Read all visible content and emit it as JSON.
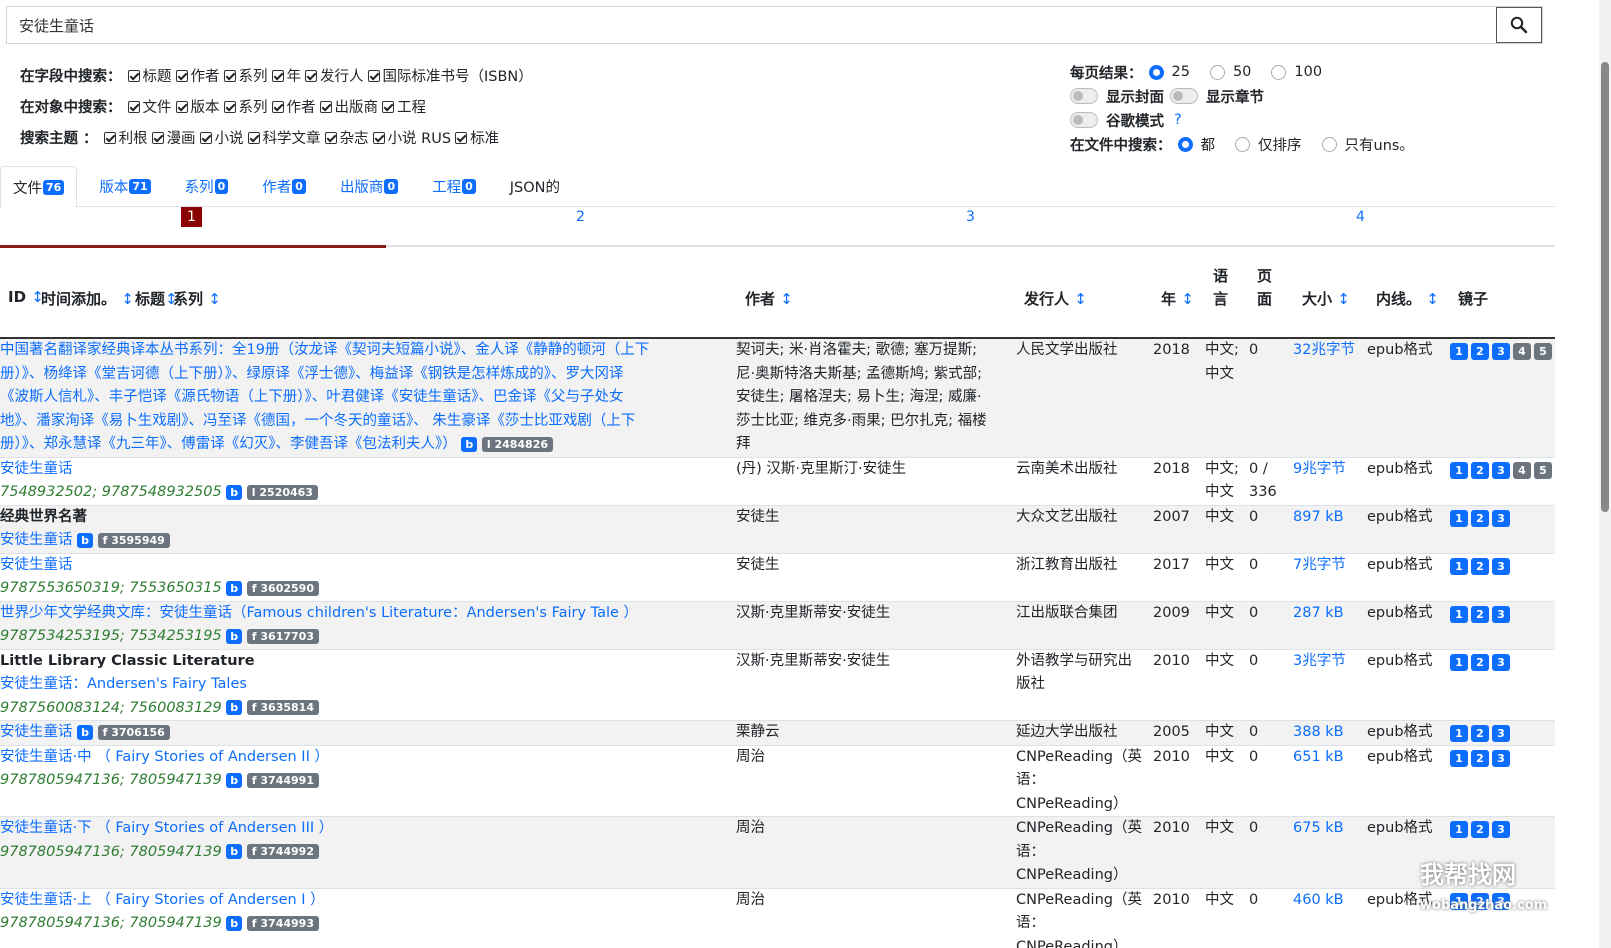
{
  "search": {
    "value": "安徒生童话"
  },
  "filters": {
    "fields_label": "在字段中搜索：",
    "fields": [
      "标题",
      "作者",
      "系列",
      "年",
      "发行人",
      "国际标准书号（ISBN）"
    ],
    "objects_label": "在对象中搜索：",
    "objects": [
      "文件",
      "版本",
      "系列",
      "作者",
      "出版商",
      "工程"
    ],
    "topics_label": "搜索主题 ：",
    "topics": [
      "利根",
      "漫画",
      "小说",
      "科学文章",
      "杂志",
      "小说 RUS",
      "标准"
    ]
  },
  "options": {
    "per_page_label": "每页结果：",
    "per_page": [
      "25",
      "50",
      "100"
    ],
    "show_cover": "显示封面",
    "show_chapters": "显示章节",
    "google_mode": "谷歌模式",
    "help": "?",
    "search_in_files_label": "在文件中搜索：",
    "search_in_files": [
      "都",
      "仅排序",
      "只有uns。"
    ]
  },
  "tabs": [
    {
      "label": "文件",
      "count": "76"
    },
    {
      "label": "版本",
      "count": "71"
    },
    {
      "label": "系列",
      "count": "0"
    },
    {
      "label": "作者",
      "count": "0"
    },
    {
      "label": "出版商",
      "count": "0"
    },
    {
      "label": "工程",
      "count": "0"
    },
    {
      "label": "JSON的",
      "count": ""
    }
  ],
  "pager": [
    "1",
    "2",
    "3",
    "4"
  ],
  "headers": {
    "id": "ID",
    "time_added": "时间添加。",
    "title": "标题",
    "series": "系列",
    "author": "作者",
    "publisher": "发行人",
    "year": "年",
    "language": "语言",
    "pages": "页面",
    "size": "大小",
    "ext": "内线。",
    "mirrors": "镜子",
    "sort_icon": "↕"
  },
  "rows": [
    {
      "title_lines": [
        "中国著名翻译家经典译本丛书系列：全19册（汝龙译《契诃夫短篇小说》、金人译《静静的顿河（上下",
        "册）》、杨绛译《堂吉诃德（上下册）》、绿原译《浮士德》、梅益译《钢铁是怎样炼成的》、罗大冈译",
        "《波斯人信札》、丰子恺译《源氏物语（上下册）》、叶君健译《安徒生童话》、巴金译《父与子处女",
        "地》、潘家洵译《易卜生戏剧》、冯至译《德国，一个冬天的童话》、 朱生豪译《莎士比亚戏剧（上下",
        "册）》、郑永慧译《九三年》、傅雷译《幻灭》、李健吾译《包法利夫人》）"
      ],
      "b": "b",
      "f": "l 2484826",
      "author_lines": [
        "契诃夫; 米·肖洛霍夫; 歌德; 塞万提斯;",
        "尼·奥斯特洛夫斯基; 孟德斯鸠; 紫式部;",
        "安徒生; 屠格涅夫; 易卜生; 海涅; 威廉·",
        "莎士比亚; 维克多·雨果; 巴尔扎克; 福楼",
        "拜"
      ],
      "publisher_lines": [
        "人民文学出版社"
      ],
      "year": "2018",
      "lang_lines": [
        "中文;",
        "中文"
      ],
      "pages_lines": [
        "0"
      ],
      "size": "32兆字节",
      "ext": "epub格式",
      "mirrors": [
        "1",
        "2",
        "3",
        "4",
        "5"
      ]
    },
    {
      "title_lines": [
        "安徒生童话"
      ],
      "isbn": "7548932502; 9787548932505",
      "b": "b",
      "f": "l 2520463",
      "author_lines": [
        "(丹) 汉斯·克里斯汀·安徒生"
      ],
      "publisher_lines": [
        "云南美术出版社"
      ],
      "year": "2018",
      "lang_lines": [
        "中文;",
        "中文"
      ],
      "pages_lines": [
        "0 /",
        "336"
      ],
      "size": "9兆字节",
      "ext": "epub格式",
      "mirrors": [
        "1",
        "2",
        "3",
        "4",
        "5"
      ]
    },
    {
      "series": "经典世界名著",
      "title_lines": [
        "安徒生童话"
      ],
      "b": "b",
      "f": "f 3595949",
      "author_lines": [
        "安徒生"
      ],
      "publisher_lines": [
        "大众文艺出版社"
      ],
      "year": "2007",
      "lang_lines": [
        "中文"
      ],
      "pages_lines": [
        "0"
      ],
      "size": "897 kB",
      "ext": "epub格式",
      "mirrors": [
        "1",
        "2",
        "3"
      ]
    },
    {
      "title_lines": [
        "安徒生童话"
      ],
      "isbn": "9787553650319; 7553650315",
      "b": "b",
      "f": "f 3602590",
      "author_lines": [
        "安徒生"
      ],
      "publisher_lines": [
        "浙江教育出版社"
      ],
      "year": "2017",
      "lang_lines": [
        "中文"
      ],
      "pages_lines": [
        "0"
      ],
      "size": "7兆字节",
      "ext": "epub格式",
      "mirrors": [
        "1",
        "2",
        "3"
      ]
    },
    {
      "title_lines": [
        "世界少年文学经典文库：安徒生童话（Famous children's Literature：Andersen's Fairy Tale ）"
      ],
      "isbn": "9787534253195; 7534253195",
      "b": "b",
      "f": "f 3617703",
      "author_lines": [
        "汉斯·克里斯蒂安·安徒生"
      ],
      "publisher_lines": [
        "江出版联合集团"
      ],
      "year": "2009",
      "lang_lines": [
        "中文"
      ],
      "pages_lines": [
        "0"
      ],
      "size": "287 kB",
      "ext": "epub格式",
      "mirrors": [
        "1",
        "2",
        "3"
      ]
    },
    {
      "series": "Little Library Classic Literature",
      "title_lines": [
        "安徒生童话：Andersen's Fairy Tales"
      ],
      "isbn": "9787560083124; 7560083129",
      "b": "b",
      "f": "f 3635814",
      "author_lines": [
        "汉斯·克里斯蒂安·安徒生"
      ],
      "publisher_lines": [
        "外语教学与研究出",
        "版社"
      ],
      "year": "2010",
      "lang_lines": [
        "中文"
      ],
      "pages_lines": [
        "0"
      ],
      "size": "3兆字节",
      "ext": "epub格式",
      "mirrors": [
        "1",
        "2",
        "3"
      ]
    },
    {
      "title_lines": [
        "安徒生童话"
      ],
      "b": "b",
      "f": "f 3706156",
      "author_lines": [
        "栗静云"
      ],
      "publisher_lines": [
        "延边大学出版社"
      ],
      "year": "2005",
      "lang_lines": [
        "中文"
      ],
      "pages_lines": [
        "0"
      ],
      "size": "388 kB",
      "ext": "epub格式",
      "mirrors": [
        "1",
        "2",
        "3"
      ]
    },
    {
      "title_lines": [
        "安徒生童话·中 （ Fairy Stories of Andersen II ）"
      ],
      "isbn": "9787805947136; 7805947139",
      "b": "b",
      "f": "f 3744991",
      "author_lines": [
        "周治"
      ],
      "publisher_lines": [
        "CNPeReading（英",
        "语：",
        "CNPeReading）"
      ],
      "year": "2010",
      "lang_lines": [
        "中文"
      ],
      "pages_lines": [
        "0"
      ],
      "size": "651 kB",
      "ext": "epub格式",
      "mirrors": [
        "1",
        "2",
        "3"
      ]
    },
    {
      "title_lines": [
        "安徒生童话·下 （ Fairy Stories of Andersen III ）"
      ],
      "isbn": "9787805947136; 7805947139",
      "b": "b",
      "f": "f 3744992",
      "author_lines": [
        "周治"
      ],
      "publisher_lines": [
        "CNPeReading（英",
        "语：",
        "CNPeReading）"
      ],
      "year": "2010",
      "lang_lines": [
        "中文"
      ],
      "pages_lines": [
        "0"
      ],
      "size": "675 kB",
      "ext": "epub格式",
      "mirrors": [
        "1",
        "2",
        "3"
      ]
    },
    {
      "title_lines": [
        "安徒生童话·上 （ Fairy Stories of Andersen I ）"
      ],
      "isbn": "9787805947136; 7805947139",
      "b": "b",
      "f": "f 3744993",
      "author_lines": [
        "周治"
      ],
      "publisher_lines": [
        "CNPeReading（英",
        "语：",
        "CNPeReading）"
      ],
      "year": "2010",
      "lang_lines": [
        "中文"
      ],
      "pages_lines": [
        "0"
      ],
      "size": "460 kB",
      "ext": "epub格式",
      "mirrors": [
        "1",
        "2",
        "3"
      ]
    }
  ],
  "watermark": {
    "text": "我帮找网",
    "url": "wobangzhao.com"
  }
}
